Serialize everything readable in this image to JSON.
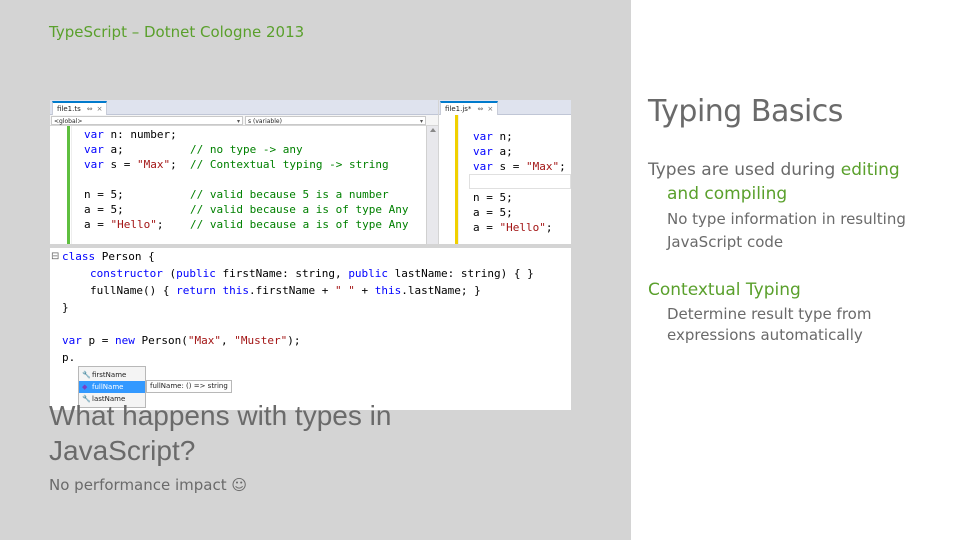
{
  "slide": {
    "header": "TypeScript – Dotnet Cologne 2013",
    "question": "What happens with types in JavaScript?",
    "footnote": "No performance impact ☺",
    "title": "Typing Basics",
    "bullet1_prefix": "Types are used during ",
    "bullet1_highlight_a": "editing",
    "bullet1_highlight_b": "and compiling",
    "bullet1_sub_a": "No type information in resulting",
    "bullet1_sub_b": "JavaScript code",
    "bullet2": "Contextual Typing",
    "bullet2_sub_a": "Determine result type from",
    "bullet2_sub_b": "expressions automatically"
  },
  "ts_editor": {
    "tab_label": "file1.ts",
    "tab_pin": "⇔",
    "tab_close": "×",
    "nav_left": "<global>",
    "nav_right": "s (variable)",
    "lines": [
      {
        "kw": "var ",
        "txt": "n: number;",
        "cm": ""
      },
      {
        "kw": "var ",
        "txt": "a;          ",
        "cm": "// no type -> any"
      },
      {
        "kw": "var ",
        "txt": "s = ",
        "str": "\"Max\"",
        "txt2": ";  ",
        "cm": "// Contextual typing -> string"
      },
      {
        "kw": "",
        "txt": "",
        "cm": ""
      },
      {
        "kw": "",
        "txt": "n = 5;          ",
        "cm": "// valid because 5 is a number"
      },
      {
        "kw": "",
        "txt": "a = 5;          ",
        "cm": "// valid because a is of type Any"
      },
      {
        "kw": "",
        "txt": "a = ",
        "str": "\"Hello\"",
        "txt2": ";    ",
        "cm": "// valid because a is of type Any"
      }
    ]
  },
  "js_editor": {
    "tab_label": "file1.js*",
    "tab_pin": "⇔",
    "tab_close": "×",
    "lines": [
      {
        "kw": "var ",
        "txt": "n;"
      },
      {
        "kw": "var ",
        "txt": "a;"
      },
      {
        "kw": "var ",
        "txt": "s = ",
        "str": "\"Max\"",
        "txt2": ";"
      },
      {
        "kw": "",
        "txt": ""
      },
      {
        "kw": "",
        "txt": "n = 5;"
      },
      {
        "kw": "",
        "txt": "a = 5;"
      },
      {
        "kw": "",
        "txt": "a = ",
        "str": "\"Hello\"",
        "txt2": ";"
      }
    ]
  },
  "class_editor": {
    "l1_kw": "class ",
    "l1_txt": "Person {",
    "l2_kw": "constructor ",
    "l2_a": "(",
    "l2_kw2": "public ",
    "l2_b": "firstName: string, ",
    "l2_kw3": "public ",
    "l2_c": "lastName: string) { }",
    "l3_a": "fullName() { ",
    "l3_kw": "return this",
    "l3_b": ".firstName + ",
    "l3_str": "\" \"",
    "l3_c": " + ",
    "l3_kw2": "this",
    "l3_d": ".lastName; }",
    "l4": "}",
    "l6_kw": "var ",
    "l6_a": "p = ",
    "l6_kw2": "new ",
    "l6_b": "Person(",
    "l6_str1": "\"Max\"",
    "l6_c": ", ",
    "l6_str2": "\"Muster\"",
    "l6_d": ");",
    "l7": "p.",
    "fold": "⊟"
  },
  "completion": {
    "items": [
      "firstName",
      "fullName",
      "lastName"
    ],
    "selected_index": 1,
    "tooltip": "fullName: () => string"
  }
}
